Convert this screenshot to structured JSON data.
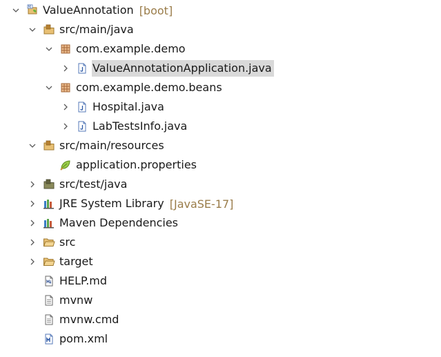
{
  "tree": {
    "project": {
      "label": "ValueAnnotation",
      "decoration": "[boot]"
    },
    "src_main_java": {
      "label": "src/main/java"
    },
    "pkg_demo": {
      "label": "com.example.demo"
    },
    "file_app": {
      "label": "ValueAnnotationApplication.java"
    },
    "pkg_beans": {
      "label": "com.example.demo.beans"
    },
    "file_hospital": {
      "label": "Hospital.java"
    },
    "file_labtests": {
      "label": "LabTestsInfo.java"
    },
    "src_main_resources": {
      "label": "src/main/resources"
    },
    "file_props": {
      "label": "application.properties"
    },
    "src_test_java": {
      "label": "src/test/java"
    },
    "jre": {
      "label": "JRE System Library",
      "decoration": "[JavaSE-17]"
    },
    "maven": {
      "label": "Maven Dependencies"
    },
    "src": {
      "label": "src"
    },
    "target": {
      "label": "target"
    },
    "help": {
      "label": "HELP.md"
    },
    "mvnw": {
      "label": "mvnw"
    },
    "mvnw_cmd": {
      "label": "mvnw.cmd"
    },
    "pom": {
      "label": "pom.xml"
    }
  },
  "colors": {
    "selection": "#d9d9d9",
    "decoration": "#9a7c49",
    "chevron": "#5a5a5a"
  }
}
